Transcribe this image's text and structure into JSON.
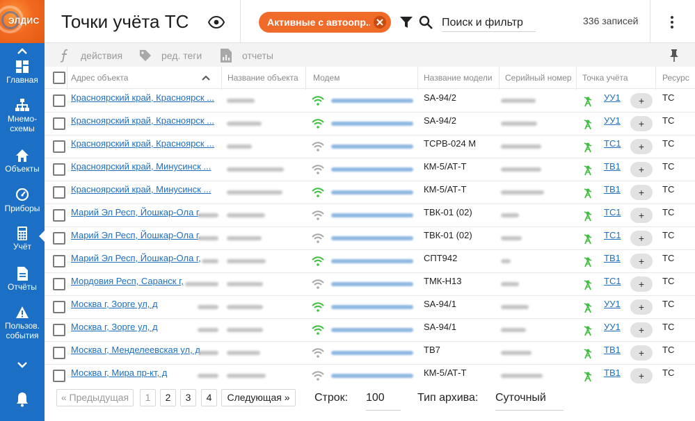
{
  "logo": {
    "text": "ЭЛДИС"
  },
  "sidebar": {
    "items": [
      {
        "label": "Главная",
        "icon": "dashboard-icon"
      },
      {
        "label": "Мнемо-\nсхемы",
        "icon": "hierarchy-icon"
      },
      {
        "label": "Объекты",
        "icon": "home-icon"
      },
      {
        "label": "Приборы",
        "icon": "gauge-icon"
      },
      {
        "label": "Учёт",
        "icon": "calculator-icon",
        "active": true
      },
      {
        "label": "Отчёты",
        "icon": "document-icon"
      },
      {
        "label": "Пользов.\nсобытия",
        "icon": "warning-icon"
      }
    ]
  },
  "header": {
    "title": "Точки учёта ТС",
    "filter_chip": "Активные с автоопр...",
    "search_placeholder": "Поиск и фильтр",
    "record_count": "336 записей"
  },
  "toolbar": {
    "actions": "действия",
    "edit_tags": "ред. теги",
    "reports": "отчеты"
  },
  "table": {
    "columns": [
      "Адрес объекта",
      "Название объекта",
      "Модем",
      "Название модели",
      "Серийный номер",
      "Точка учёта",
      "Ресурс"
    ],
    "add_label": "+",
    "rows": [
      {
        "address": "Красноярский край, Красноярск ...",
        "modem_status": "online",
        "model": "SA-94/2",
        "point": "УУ1",
        "resource": "ТС"
      },
      {
        "address": "Красноярский край, Красноярск ...",
        "modem_status": "online",
        "model": "SA-94/2",
        "point": "УУ1",
        "resource": "ТС"
      },
      {
        "address": "Красноярский край, Красноярск ...",
        "modem_status": "offline",
        "model": "ТСРВ-024 М",
        "point": "ТС1",
        "resource": "ТС"
      },
      {
        "address": "Красноярский край, Минусинск ...",
        "modem_status": "offline",
        "model": "КМ-5/АТ-Т",
        "point": "ТВ1",
        "resource": "ТС"
      },
      {
        "address": "Красноярский край, Минусинск ...",
        "modem_status": "online",
        "model": "КМ-5/АТ-Т",
        "point": "ТВ1",
        "resource": "ТС"
      },
      {
        "address": "Марий Эл Респ, Йошкар-Ола г,",
        "modem_status": "offline",
        "model": "ТВК-01 (02)",
        "point": "ТС1",
        "resource": "ТС"
      },
      {
        "address": "Марий Эл Респ, Йошкар-Ола г,",
        "modem_status": "offline",
        "model": "ТВК-01 (02)",
        "point": "ТС1",
        "resource": "ТС"
      },
      {
        "address": "Марий Эл Респ, Йошкар-Ола г,",
        "modem_status": "online",
        "model": "СПТ942",
        "point": "ТВ1",
        "resource": "ТС"
      },
      {
        "address": "Мордовия Респ, Саранск г,",
        "modem_status": "offline",
        "model": "ТМК-Н13",
        "point": "ТС1",
        "resource": "ТС"
      },
      {
        "address": "Москва г, Зорге ул, д",
        "modem_status": "online",
        "model": "SA-94/1",
        "point": "УУ1",
        "resource": "ТС"
      },
      {
        "address": "Москва г, Зорге ул, д",
        "modem_status": "online",
        "model": "SA-94/1",
        "point": "УУ1",
        "resource": "ТС"
      },
      {
        "address": "Москва г, Менделеевская ул, д",
        "modem_status": "offline",
        "model": "ТВ7",
        "point": "ТВ1",
        "resource": "ТС"
      },
      {
        "address": "Москва г, Мира пр-кт, д",
        "modem_status": "offline",
        "model": "КМ-5/АТ-Т",
        "point": "ТВ1",
        "resource": "ТС"
      }
    ]
  },
  "pagination": {
    "prev": "« Предыдущая",
    "pages": [
      "1",
      "2",
      "3",
      "4"
    ],
    "current_page": "1",
    "next": "Следующая »",
    "rows_label": "Строк:",
    "rows_value": "100",
    "archive_label": "Тип архива:",
    "archive_value": "Суточный"
  },
  "colors": {
    "sidebar": "#1b6fc4",
    "accent_orange": "#f06b2a",
    "link": "#1e6fc0",
    "modem_online": "#3fbf3f",
    "modem_offline": "#a8a8a8",
    "meter_green": "#3fbf3f"
  }
}
